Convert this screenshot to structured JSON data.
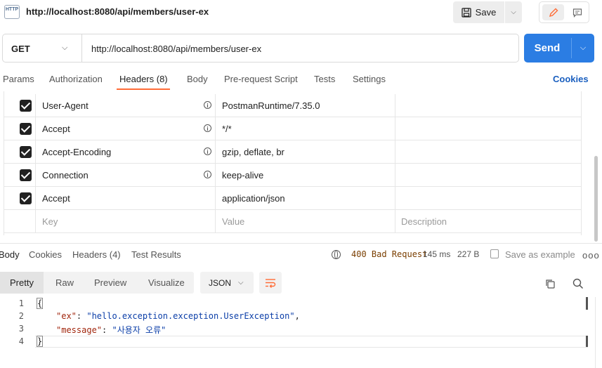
{
  "request": {
    "title": "http://localhost:8080/api/members/user-ex",
    "icon_label": "HTTP",
    "save_label": "Save",
    "method": "GET",
    "url": "http://localhost:8080/api/members/user-ex",
    "send_label": "Send"
  },
  "tabs": [
    {
      "label": "Params"
    },
    {
      "label": "Authorization"
    },
    {
      "label": "Headers (8)"
    },
    {
      "label": "Body"
    },
    {
      "label": "Pre-request Script"
    },
    {
      "label": "Tests"
    },
    {
      "label": "Settings"
    }
  ],
  "cookies_label": "Cookies",
  "headers": [
    {
      "key": "User-Agent",
      "value": "PostmanRuntime/7.35.0",
      "checked": true
    },
    {
      "key": "Accept",
      "value": "*/*",
      "checked": true
    },
    {
      "key": "Accept-Encoding",
      "value": "gzip, deflate, br",
      "checked": true
    },
    {
      "key": "Connection",
      "value": "keep-alive",
      "checked": true
    },
    {
      "key": "Accept",
      "value": "application/json",
      "checked": true
    }
  ],
  "placeholders": {
    "key": "Key",
    "value": "Value",
    "description": "Description"
  },
  "response": {
    "tabs": [
      {
        "label": "Body"
      },
      {
        "label": "Cookies"
      },
      {
        "label": "Headers (4)"
      },
      {
        "label": "Test Results"
      }
    ],
    "status": "400 Bad Request",
    "time": "145 ms",
    "size": "227 B",
    "save_example": "Save as example",
    "more": "ooo"
  },
  "view_modes": [
    {
      "label": "Pretty"
    },
    {
      "label": "Raw"
    },
    {
      "label": "Preview"
    },
    {
      "label": "Visualize"
    }
  ],
  "format": "JSON",
  "code": {
    "line_numbers": [
      "1",
      "2",
      "3",
      "4"
    ],
    "open_brace": "{",
    "close_brace": "}",
    "lines": [
      {
        "key": "\"ex\"",
        "sep": ": ",
        "value": "\"hello.exception.exception.UserException\"",
        "trail": ","
      },
      {
        "key": "\"message\"",
        "sep": ": ",
        "value": "\"사용자 오류\"",
        "trail": ""
      }
    ]
  },
  "colors": {
    "send": "#2b7de3",
    "accent": "#ff6c37",
    "cookies_link": "#1a5fbf",
    "status_code": "#7a3e00"
  }
}
